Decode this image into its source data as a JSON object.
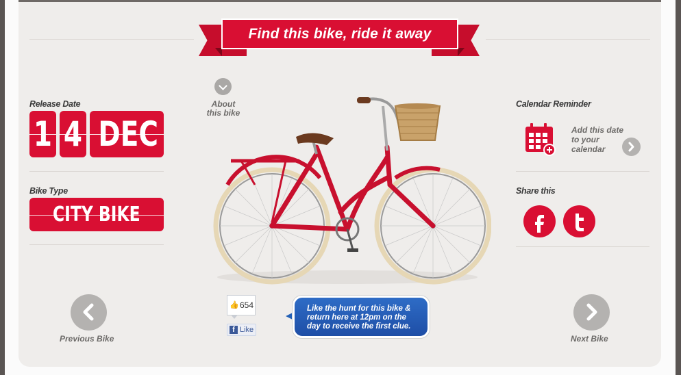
{
  "banner": {
    "title": "Find this bike, ride it away"
  },
  "release": {
    "label": "Release Date",
    "day_digits": [
      "1",
      "4"
    ],
    "month": "DEC"
  },
  "bike_type": {
    "label": "Bike Type",
    "value": "CITY BIKE"
  },
  "about": {
    "line1": "About",
    "line2": "this bike"
  },
  "calendar": {
    "label": "Calendar Reminder",
    "line1": "Add this date",
    "line2": "to your",
    "line3": "calendar"
  },
  "share": {
    "label": "Share this"
  },
  "nav": {
    "previous": "Previous Bike",
    "next": "Next Bike"
  },
  "facebook": {
    "count": "654",
    "like_label": "Like"
  },
  "promo": {
    "line1": "Like the hunt for this bike &",
    "line2": "return here at 12pm on the",
    "line3": "day to receive the first clue."
  },
  "colors": {
    "brand_red": "#d90f33",
    "panel_bg": "#efedeb",
    "bubble_blue": "#2a62bd"
  },
  "icons": [
    "chevron-down-icon",
    "calendar-plus-icon",
    "chevron-right-icon",
    "chevron-left-icon",
    "facebook-icon",
    "twitter-icon",
    "thumbs-up-icon"
  ]
}
